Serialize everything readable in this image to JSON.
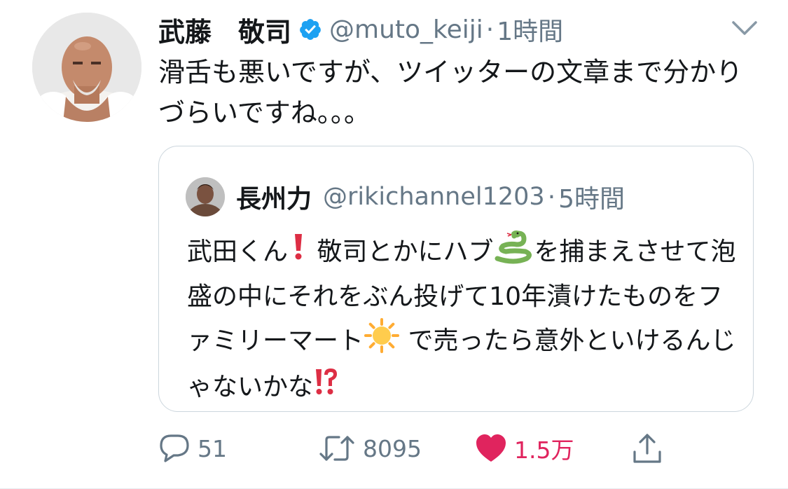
{
  "tweet": {
    "display_name": "武藤　敬司",
    "handle": "@muto_keiji",
    "separator": "·",
    "time": "1時間",
    "text": "滑舌も悪いですが、ツイッターの文章まで分かりづらいですね。。。",
    "verified": true,
    "menu_icon": "chevron-down-icon"
  },
  "quote": {
    "display_name": "長州力",
    "handle": "@rikichannel1203",
    "separator": "·",
    "time": "5時間",
    "text_parts": {
      "p1": "武田くん",
      "p2": " 敬司とかにハブ",
      "p3": "を捕まえさせて泡盛の中にそれをぶん投げて10年漬けたものをファミリーマート",
      "p4": " で売ったら意外といけるんじゃないかな"
    },
    "emojis": [
      "exclamation-emoji",
      "snake-emoji",
      "sun-emoji",
      "interrobang-emoji"
    ]
  },
  "actions": {
    "reply": {
      "icon": "reply-icon",
      "count": "51"
    },
    "retweet": {
      "icon": "retweet-icon",
      "count": "8095"
    },
    "like": {
      "icon": "heart-icon",
      "count": "1.5万",
      "liked": true
    },
    "share": {
      "icon": "share-icon"
    }
  },
  "colors": {
    "text": "#14171a",
    "secondary": "#657786",
    "verified": "#1da1f2",
    "like": "#e0245e",
    "border": "#ccd6dd"
  }
}
